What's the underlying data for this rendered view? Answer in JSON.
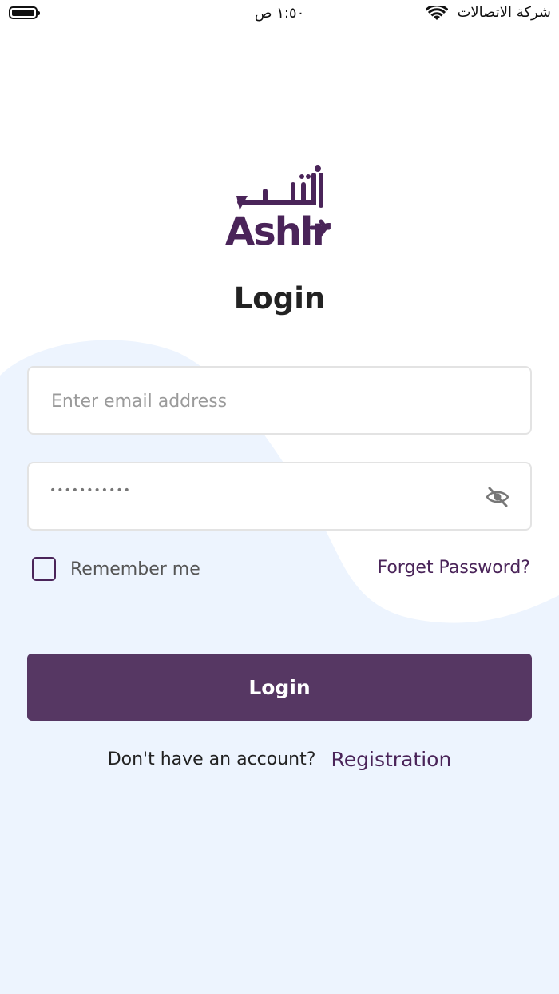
{
  "status_bar": {
    "time": "١:٥٠ ص",
    "carrier": "شركة الاتصالات",
    "battery_icon": "battery-icon",
    "wifi_icon": "wifi-icon"
  },
  "logo": {
    "arabic_wordmark": "أشر",
    "latin_wordmark": "Ashlr",
    "brand_color": "#4a2459"
  },
  "page": {
    "title": "Login"
  },
  "form": {
    "email_placeholder": "Enter email address",
    "email_value": "",
    "password_masked": "•••••••••••",
    "password_toggle_icon": "eye-off-icon",
    "remember_label": "Remember me",
    "remember_checked": false,
    "forget_password_label": "Forget Password?",
    "login_button_label": "Login"
  },
  "footer": {
    "question": "Don't have an account?",
    "registration_label": "Registration"
  },
  "colors": {
    "primary_button": "#563763",
    "background_wave": "#edf4fe",
    "accent_text": "#4a2459"
  }
}
